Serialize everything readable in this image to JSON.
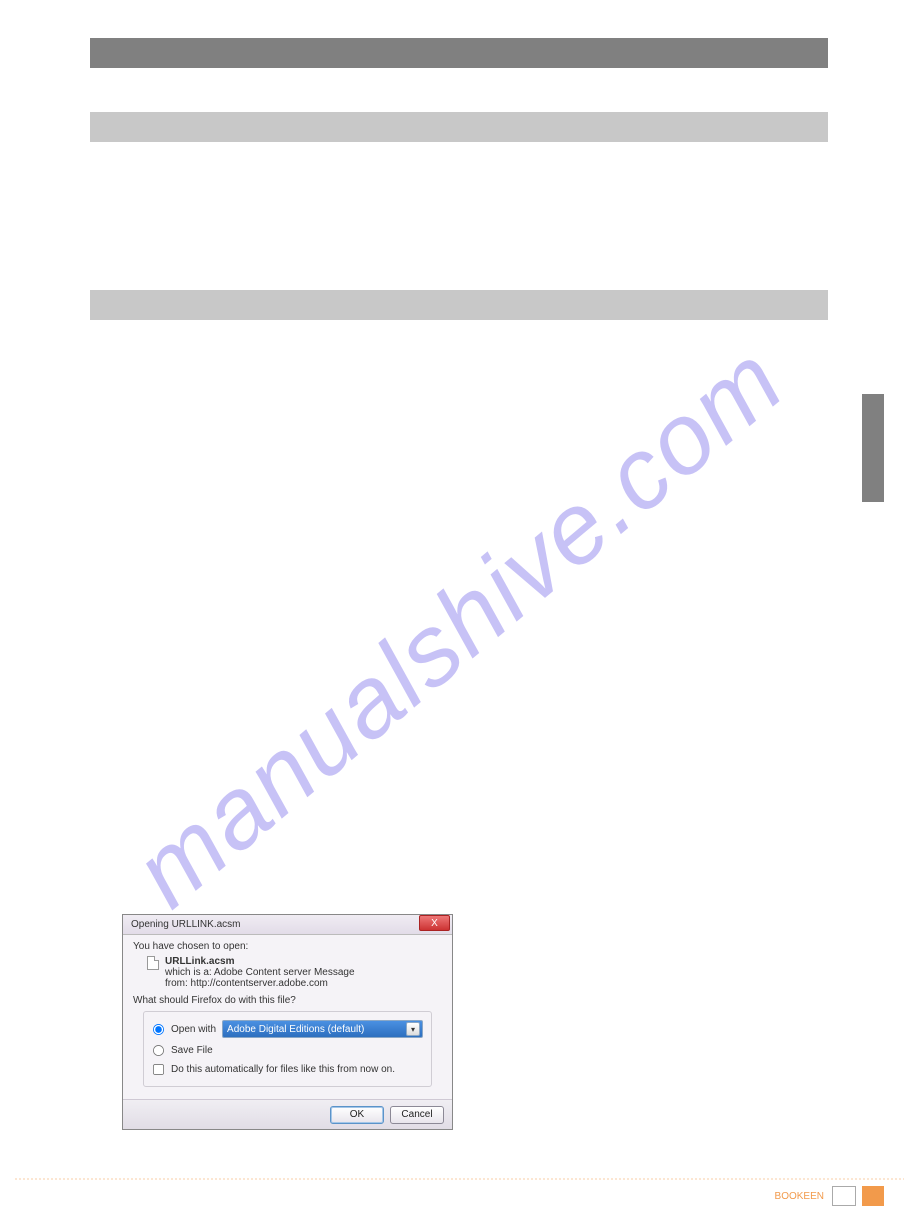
{
  "watermark": "manualshive.com",
  "bars": {
    "dark": "",
    "grey1": "",
    "grey2": ""
  },
  "dialog": {
    "title": "Opening URLLINK.acsm",
    "chosen_label": "You have chosen to open:",
    "file_name": "URLLink.acsm",
    "file_which": "which is a: Adobe Content server Message",
    "file_from": "from: http://contentserver.adobe.com",
    "question": "What should Firefox do with this file?",
    "open_with_label": "Open with",
    "open_with_app": "Adobe Digital Editions (default)",
    "save_file_label": "Save File",
    "auto_label": "Do this automatically for files like this from now on.",
    "ok_label": "OK",
    "cancel_label": "Cancel",
    "close_label": "X"
  },
  "footer": {
    "text": "BOOKEEN",
    "page": ""
  }
}
